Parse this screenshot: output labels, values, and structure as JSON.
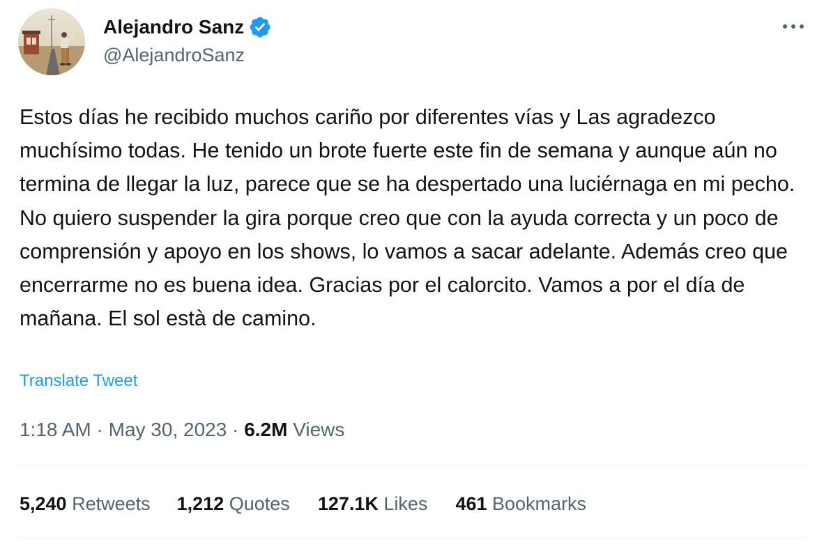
{
  "author": {
    "display_name": "Alejandro Sanz",
    "handle": "@AlejandroSanz",
    "verified": true,
    "verified_color": "#1d9bf0"
  },
  "tweet": {
    "text_lines": [
      "Estos días he recibido muchos cariño por diferentes vías y Las agradezco muchísimo todas. He tenido un brote fuerte este fin de semana y aunque aún no termina de llegar la luz, parece que se ha despertado una luciérnaga en mi pecho.",
      "No quiero suspender la gira porque creo que con la ayuda correcta y un poco de comprensión y apoyo en los shows, lo vamos a sacar adelante. Además creo que encerrarme no es buena idea. Gracias por el calorcito. Vamos a por el día de mañana. El sol està de camino."
    ],
    "translate_label": "Translate Tweet"
  },
  "meta": {
    "time": "1:18 AM",
    "separator": " · ",
    "date": "May 30, 2023",
    "views_count": "6.2M",
    "views_label": "Views"
  },
  "stats": {
    "retweets": {
      "count": "5,240",
      "label": "Retweets"
    },
    "quotes": {
      "count": "1,212",
      "label": "Quotes"
    },
    "likes": {
      "count": "127.1K",
      "label": "Likes"
    },
    "bookmarks": {
      "count": "461",
      "label": "Bookmarks"
    }
  },
  "icons": {
    "more": "more-horizontal-icon",
    "verified": "verified-badge-icon"
  },
  "colors": {
    "text_primary": "#0f1419",
    "text_secondary": "#536471",
    "link": "#1d9bf0",
    "divider": "#eff3f4"
  }
}
